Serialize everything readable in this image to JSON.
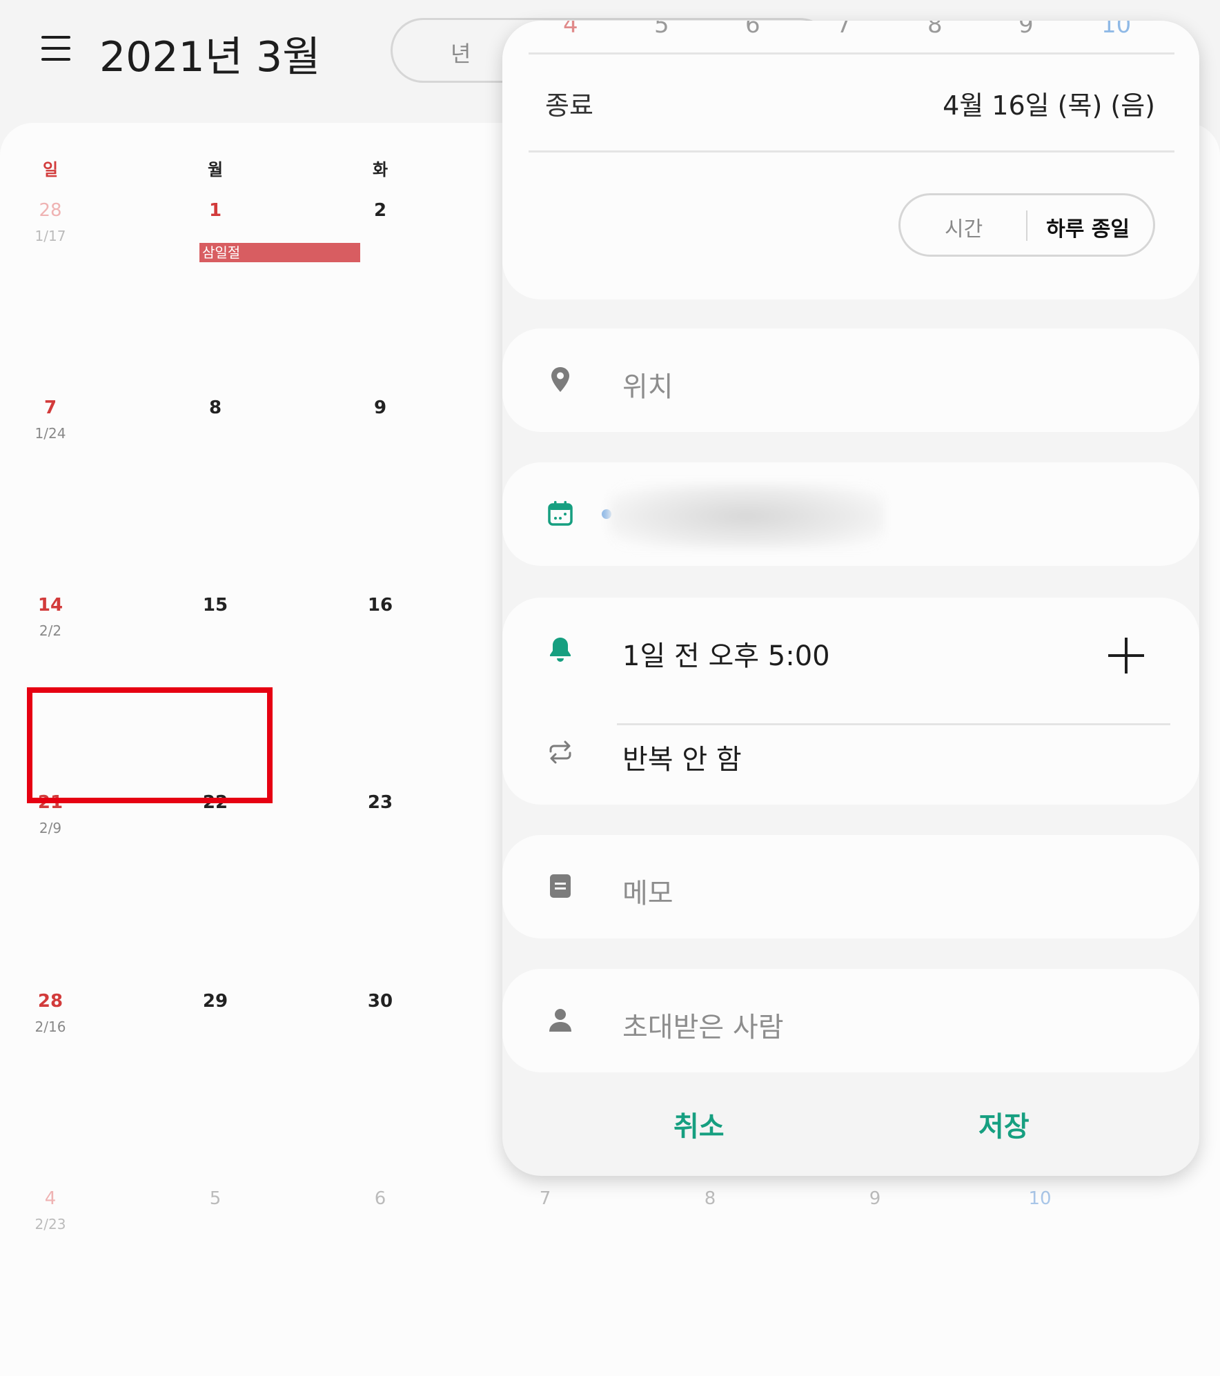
{
  "header": {
    "title": "2021년 3월",
    "view_option": "년"
  },
  "calendar": {
    "weekdays": [
      "일",
      "월",
      "화"
    ],
    "weeks": [
      {
        "sun": "28",
        "sun_lunar": "1/17",
        "mon": "1",
        "tue": "2"
      },
      {
        "sun": "7",
        "sun_lunar": "1/24",
        "mon": "8",
        "tue": "9"
      },
      {
        "sun": "14",
        "sun_lunar": "2/2",
        "mon": "15",
        "tue": "16"
      },
      {
        "sun": "21",
        "sun_lunar": "2/9",
        "mon": "22",
        "tue": "23"
      },
      {
        "sun": "28",
        "sun_lunar": "2/16",
        "mon": "29",
        "tue": "30"
      },
      {
        "sun": "4",
        "sun_lunar": "2/23",
        "mon": "5",
        "tue": "6",
        "wed": "7",
        "thu": "8",
        "fri": "9",
        "sat": "10"
      }
    ],
    "event": "삼일절"
  },
  "panel": {
    "ghost_numbers": [
      "4",
      "5",
      "6",
      "7",
      "8",
      "9",
      "10"
    ],
    "end_label": "종료",
    "end_value": "4월 16일 (목) (음)",
    "time_toggle": {
      "time": "시간",
      "all_day": "하루 종일"
    },
    "location_placeholder": "위치",
    "reminder_text": "1일 전 오후 5:00",
    "repeat_text": "반복 안 함",
    "memo_placeholder": "메모",
    "invitees_placeholder": "초대받은 사람",
    "cancel_label": "취소",
    "save_label": "저장"
  },
  "colors": {
    "accent_green": "#169f80",
    "holiday_red": "#d23b3b",
    "event_bar": "#d85d61",
    "highlight_box": "#e60012"
  },
  "icons": [
    "menu-icon",
    "location-pin-icon",
    "calendar-icon",
    "bell-icon",
    "plus-icon",
    "repeat-icon",
    "memo-icon",
    "person-icon"
  ]
}
